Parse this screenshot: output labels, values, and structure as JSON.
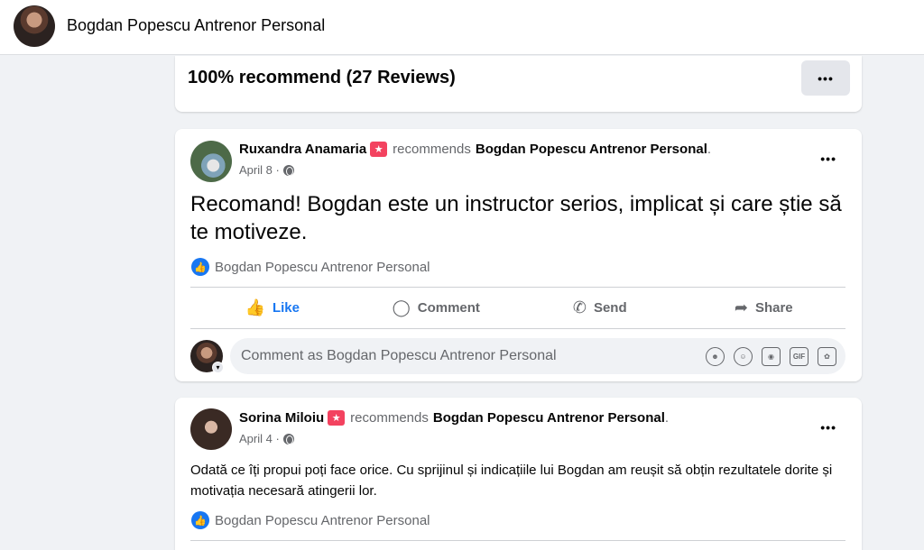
{
  "topbar": {
    "page_name": "Bogdan Popescu Antrenor Personal"
  },
  "summary": {
    "title": "100% recommend (27 Reviews)",
    "more": "•••"
  },
  "posts": [
    {
      "author": "Ruxandra Anamaria",
      "verb": "recommends",
      "target": "Bogdan Popescu Antrenor Personal",
      "period": ".",
      "date": "April 8 ·",
      "text": "Recomand! Bogdan este un instructor serios, implicat și care știe să te motiveze.",
      "reaction_by": "Bogdan Popescu Antrenor Personal",
      "more": "•••"
    },
    {
      "author": "Sorina Miloiu",
      "verb": "recommends",
      "target": "Bogdan Popescu Antrenor Personal",
      "period": ".",
      "date": "April 4 ·",
      "text": "Odată ce îți propui poți face orice. Cu sprijinul și indicațiile lui Bogdan am reușit să obțin rezultatele dorite și motivația necesară atingerii lor.",
      "reaction_by": "Bogdan Popescu Antrenor Personal",
      "more": "•••"
    }
  ],
  "actions": {
    "like": "Like",
    "comment": "Comment",
    "send": "Send",
    "share": "Share"
  },
  "comment": {
    "placeholder": "Comment as Bogdan Popescu Antrenor Personal"
  },
  "icons": {
    "like": "thumbs-up-icon",
    "comment": "speech-bubble-icon",
    "send": "whatsapp-icon",
    "share": "share-arrow-icon",
    "recommend": "star-badge-icon",
    "globe": "globe-icon"
  },
  "colors": {
    "accent": "#1877f2",
    "recommend_badge": "#f3425f",
    "muted": "#65676b"
  }
}
